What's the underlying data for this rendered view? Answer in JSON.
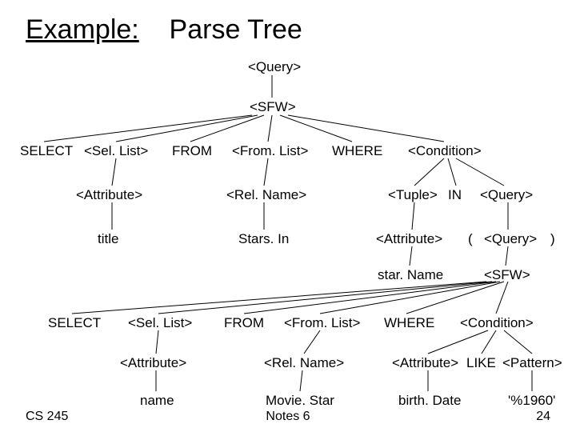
{
  "title": {
    "prefix": "Example:",
    "rest": "Parse Tree"
  },
  "footer": {
    "left": "CS 245",
    "center": "Notes 6",
    "right": "24"
  },
  "n": {
    "Query": "<Query>",
    "SFW": "<SFW>",
    "SFW2": "<SFW>",
    "SELECT": "SELECT",
    "SelList": "<Sel. List>",
    "FROM": "FROM",
    "FromList": "<From. List>",
    "WHERE": "WHERE",
    "Condition": "<Condition>",
    "Attribute": "<Attribute>",
    "RelName": "<Rel. Name>",
    "Tuple": "<Tuple>",
    "IN": "IN",
    "Query2": "<Query>",
    "title_": "title",
    "StarsIn": "Stars. In",
    "Attribute2": "<Attribute>",
    "lp": "(",
    "Query3": "<Query>",
    "rp": ")",
    "starName": "star. Name",
    "SELECT2": "SELECT",
    "SelList2": "<Sel. List>",
    "FROM2": "FROM",
    "FromList2": "<From. List>",
    "WHERE2": "WHERE",
    "Condition2": "<Condition>",
    "Attribute3": "<Attribute>",
    "RelName2": "<Rel. Name>",
    "Attribute4": "<Attribute>",
    "LIKE": "LIKE",
    "Pattern": "<Pattern>",
    "name_": "name",
    "MovieStar": "Movie. Star",
    "birthDate": "birth. Date",
    "pat": "'%1960'"
  }
}
